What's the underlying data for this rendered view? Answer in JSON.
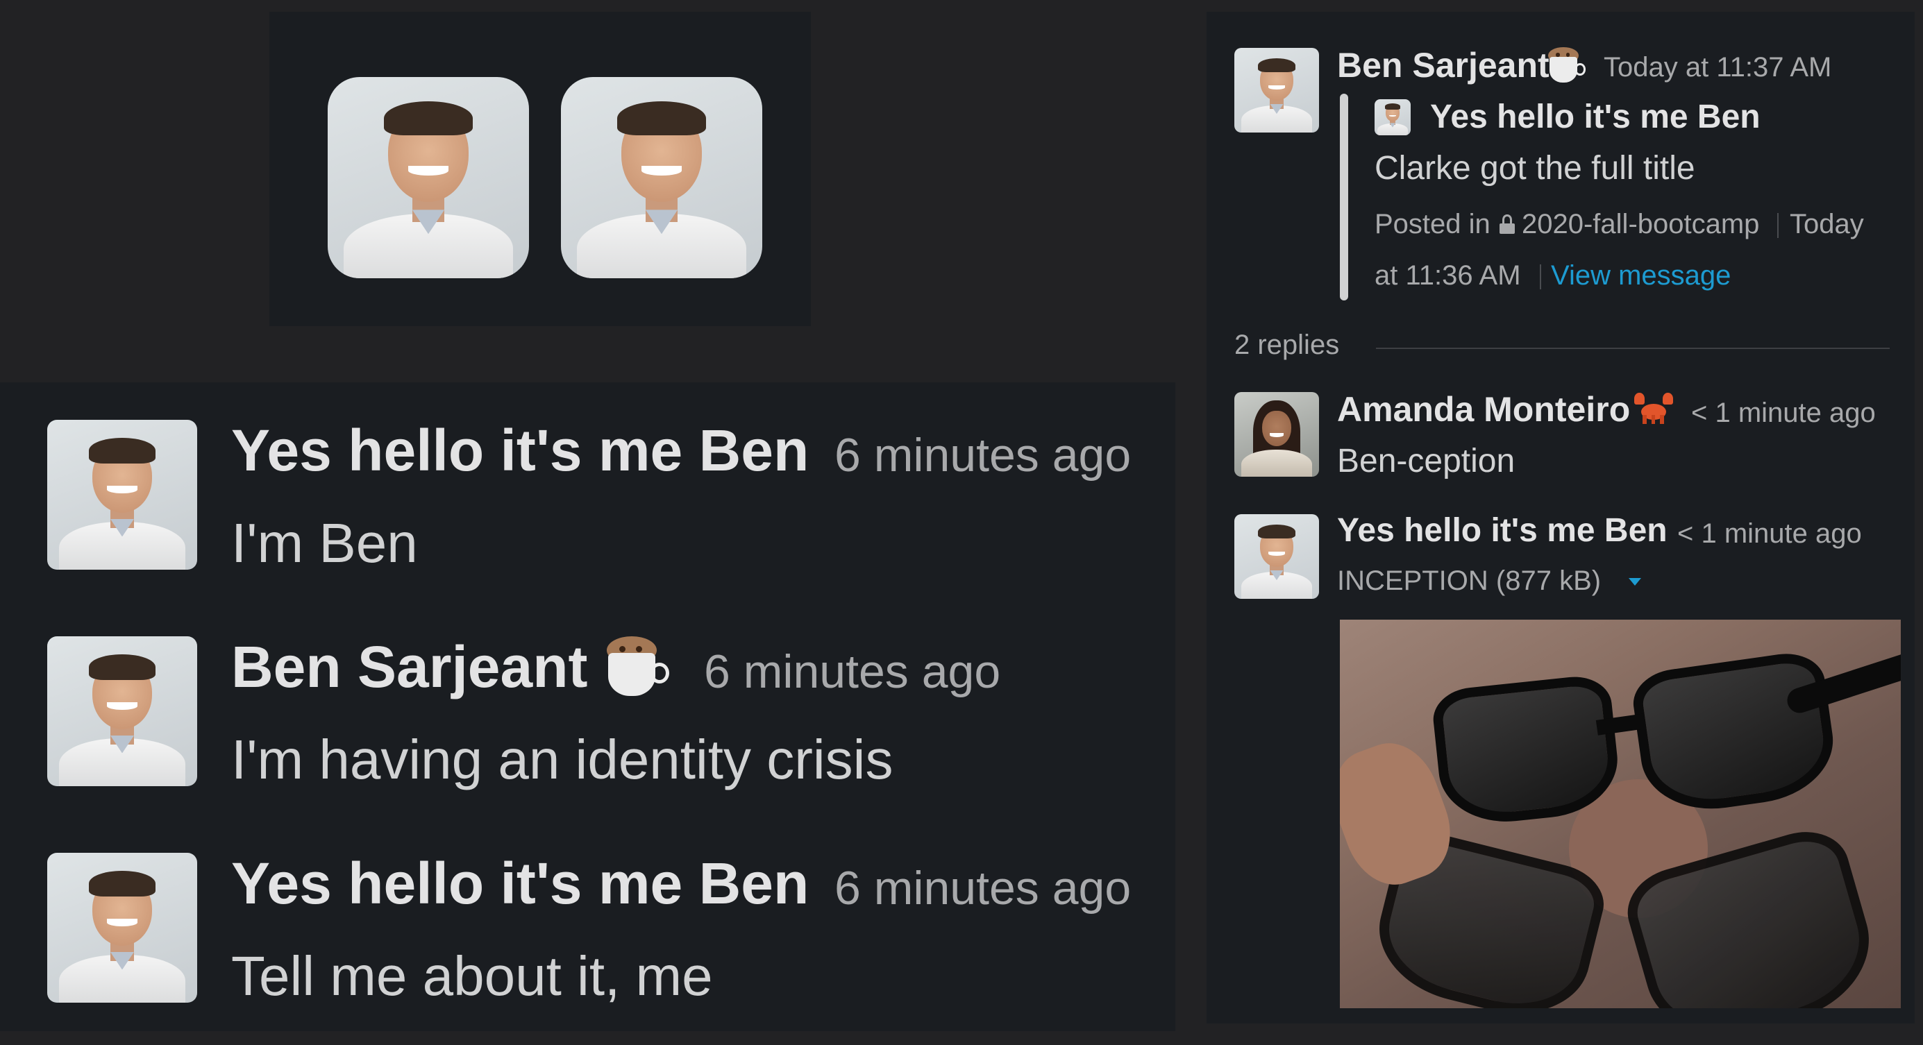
{
  "reply_avatars": {
    "count": 2
  },
  "chat": {
    "messages": [
      {
        "name": "Yes hello it's me Ben",
        "emoji": "",
        "time": "6 minutes ago",
        "text": "I'm Ben"
      },
      {
        "name": "Ben Sarjeant",
        "emoji": "coffee-emoji",
        "time": "6 minutes ago",
        "text": "I'm having an identity crisis"
      },
      {
        "name": "Yes hello it's me Ben",
        "emoji": "",
        "time": "6 minutes ago",
        "text": "Tell me about it, me"
      }
    ]
  },
  "thread": {
    "parent": {
      "name": "Ben Sarjeant",
      "emoji": "coffee-emoji",
      "time": "Today at 11:37 AM",
      "quote": {
        "author": "Yes hello it's me Ben",
        "text": "Clarke got the full title",
        "posted_in": "Posted in",
        "channel": "2020-fall-bootcamp",
        "date_part1": "Today",
        "date_part2": "at 11:36 AM",
        "view_link": "View message"
      }
    },
    "replies_label": "2 replies",
    "replies": [
      {
        "name": "Amanda Monteiro",
        "emoji": "crab-emoji",
        "time": "< 1 minute ago",
        "text": "Ben-ception"
      },
      {
        "name": "Yes hello it's me Ben",
        "emoji": "",
        "time": "< 1 minute ago",
        "attachment": "INCEPTION (877 kB)"
      }
    ]
  },
  "colors": {
    "background": "#222224",
    "panel": "#1a1d21",
    "link": "#1d9bd1",
    "muted": "#a8a9ab"
  }
}
